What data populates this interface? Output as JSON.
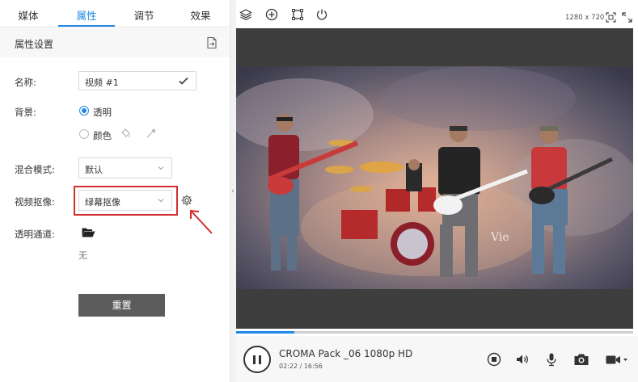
{
  "tabs": [
    {
      "label": "媒体"
    },
    {
      "label": "属性"
    },
    {
      "label": "调节"
    },
    {
      "label": "效果"
    }
  ],
  "active_tab": "属性",
  "properties": {
    "section_title": "属性设置",
    "name_label": "名称:",
    "name_value": "视频 #1",
    "background_label": "背景:",
    "bg_option_transparent": "透明",
    "bg_option_color": "颜色",
    "bg_selected": "透明",
    "blend_label": "混合模式:",
    "blend_value": "默认",
    "keying_label": "视频抠像:",
    "keying_value": "绿幕抠像",
    "alpha_label": "透明通道:",
    "alpha_value": "无",
    "reset_label": "重置"
  },
  "preview": {
    "resolution": "1280 x 720",
    "watermark": "Vie"
  },
  "player": {
    "clip_title": "CROMA Pack _06 1080p HD",
    "time": "02:22 / 16:56",
    "progress": 0.146
  },
  "colors": {
    "accent": "#1e88e5",
    "highlight_box": "#d32f2f",
    "reset_button": "#5c5c5c"
  },
  "icons": {
    "toolbar": [
      "layers-icon",
      "add-circle-icon",
      "crop-icon",
      "power-icon"
    ],
    "preview": [
      "fit-screen-icon",
      "fullscreen-icon"
    ],
    "controls": [
      "stop-icon",
      "volume-icon",
      "microphone-icon",
      "camera-icon",
      "video-camera-icon"
    ]
  }
}
